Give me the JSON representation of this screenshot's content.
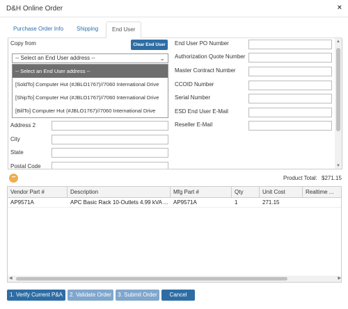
{
  "window": {
    "title": "D&H Online Order",
    "close_glyph": "×"
  },
  "tabs": [
    {
      "label": "Purchase Order Info"
    },
    {
      "label": "Shipping"
    },
    {
      "label": "End User"
    }
  ],
  "left_form": {
    "copy_from_label": "Copy from",
    "clear_button": "Clear End User",
    "select_value": "-- Select an End User address --",
    "dropdown_options": [
      "-- Select an End User address --",
      "[SoldTo] Computer Hut (#JBLO1767)//7060 International Drive",
      "[ShipTo] Computer Hut (#JBLO1767)//7060 International Drive",
      "[BillTo] Computer Hut (#JBLO1767)//7060 International Drive"
    ],
    "address2_label": "Address 2",
    "city_label": "City",
    "state_label": "State",
    "postal_label": "Postal Code"
  },
  "right_form": {
    "po_number_label": "End User PO Number",
    "auth_quote_label": "Authorization Quote Number",
    "master_contract_label": "Master Contract Number",
    "ccoid_label": "CCOID Number",
    "serial_label": "Serial Number",
    "esd_email_label": "ESD End User E-Mail",
    "reseller_email_label": "Reseller E-Mail"
  },
  "summary": {
    "product_total_label": "Product Total:",
    "product_total_value": "$271.15"
  },
  "grid": {
    "columns": [
      "Vendor Part #",
      "Description",
      "Mfg Part #",
      "Qty",
      "Unit Cost",
      "Realtime ..."
    ],
    "rows": [
      [
        "AP9571A",
        "APC Basic Rack 10-Outlets 4.99 kVA ...",
        "AP9571A",
        "1",
        "271.15",
        ""
      ]
    ]
  },
  "footer": {
    "verify": "1. Verify Current P&A",
    "validate": "2. Validate Order",
    "submit": "3. Submit Order",
    "cancel": "Cancel"
  },
  "colors": {
    "primary": "#2e6da4",
    "disabled": "#7fa6cc",
    "accent_orange": "#f0ad4e",
    "dropdown_selected": "#6e6e6e"
  }
}
